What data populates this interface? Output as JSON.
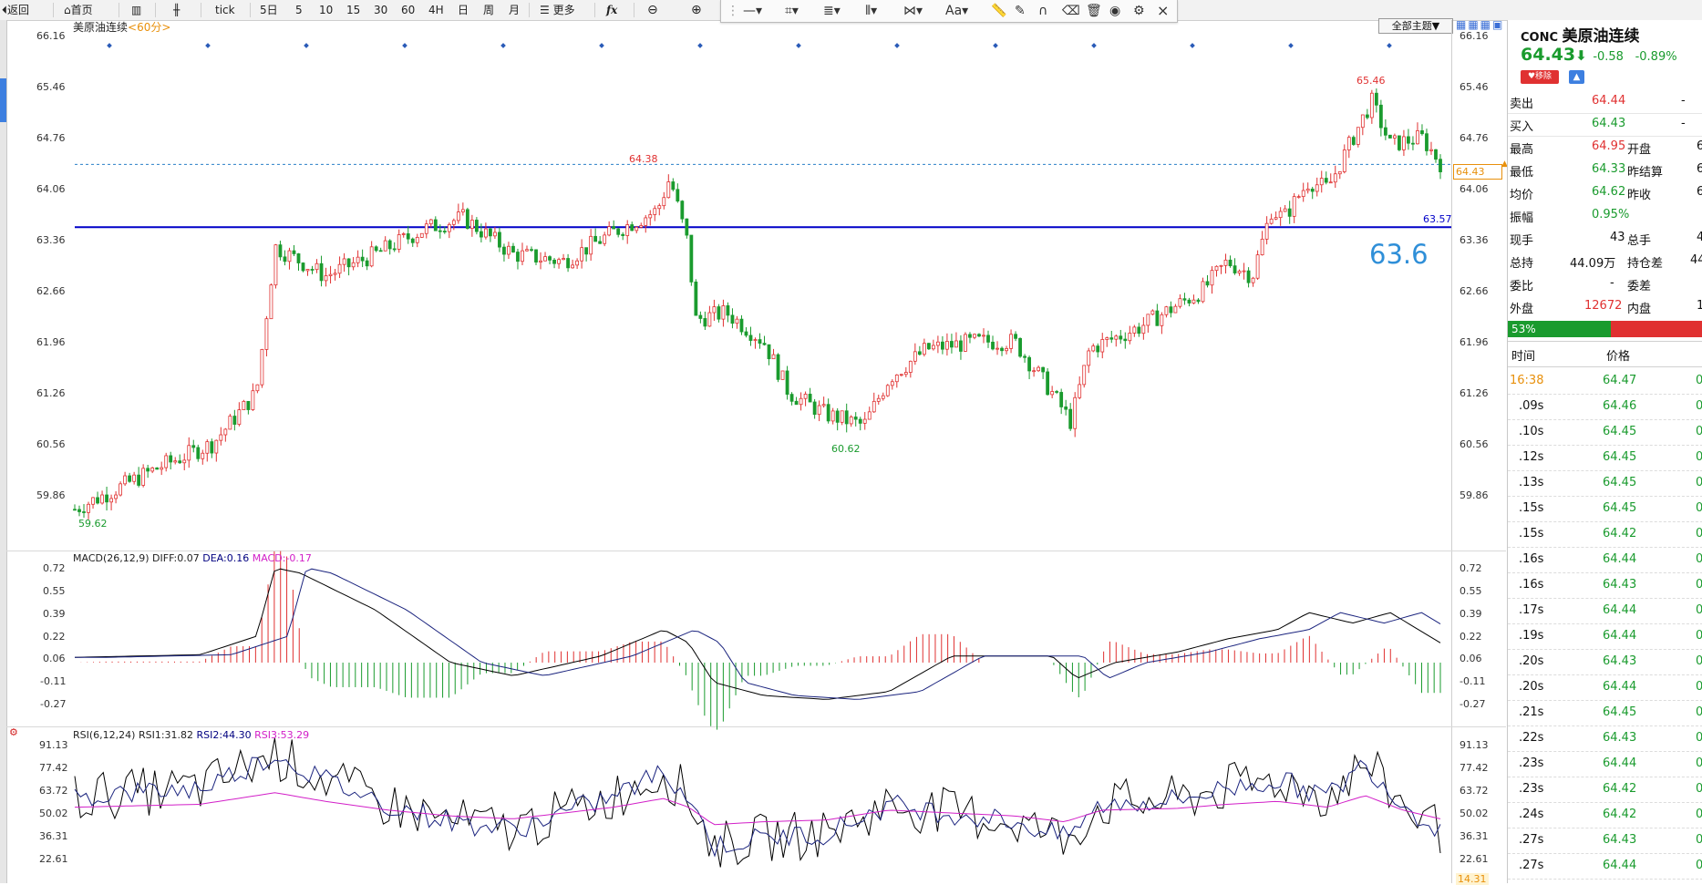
{
  "toolbar": {
    "back": "返回",
    "home": "首页",
    "tick": "tick",
    "periods": [
      "5日",
      "5",
      "10",
      "15",
      "30",
      "60",
      "4H",
      "日",
      "周",
      "月"
    ],
    "more": "更多",
    "fx": "fx"
  },
  "drawbar": {
    "close": "×",
    "text_tool": "Aa"
  },
  "chart": {
    "symbol_title": "美原油连续",
    "period_tag": "<60分>",
    "theme_button": "全部主题▼",
    "price_ticks": [
      "66.16",
      "65.46",
      "64.76",
      "64.06",
      "63.36",
      "62.66",
      "61.96",
      "61.26",
      "60.56",
      "59.86"
    ],
    "right_price_ticks": [
      "66.16",
      "65.46",
      "64.76",
      "64.06",
      "63.36",
      "62.66",
      "61.96",
      "61.26",
      "60.56",
      "59.86"
    ],
    "high_label": "65.46",
    "mid_high_label": "64.38",
    "low_label": "60.62",
    "start_low_label": "59.62",
    "hline_value": "63.57",
    "big_annotation": "63.6",
    "current_price_tag": "64.43",
    "colors": {
      "up": "#e03131",
      "down": "#1a9b2e",
      "hline": "#0000c8"
    }
  },
  "macd": {
    "title": "MACD(26,12,9)",
    "diff": "DIFF:0.07",
    "dea": "DEA:0.16",
    "macd": "MACD:-0.17",
    "ticks": [
      "0.72",
      "0.55",
      "0.39",
      "0.22",
      "0.06",
      "-0.11",
      "-0.27"
    ],
    "right_ticks": [
      "0.72",
      "0.55",
      "0.39",
      "0.22",
      "0.06",
      "-0.11",
      "-0.27"
    ]
  },
  "rsi": {
    "title": "RSI(6,12,24)",
    "rsi1": "RSI1:31.82",
    "rsi2": "RSI2:44.30",
    "rsi3": "RSI3:53.29",
    "ticks": [
      "91.13",
      "77.42",
      "63.72",
      "50.02",
      "36.31",
      "22.61"
    ],
    "right_ticks": [
      "91.13",
      "77.42",
      "63.72",
      "50.02",
      "36.31",
      "22.61"
    ],
    "bottom_right_tag": "14.31"
  },
  "quote": {
    "code": "CONC",
    "name": "美原油连续",
    "price": "64.43",
    "change": "-0.58",
    "change_pct": "-0.89%",
    "remove_btn": "移除",
    "rows": [
      {
        "l": "卖出",
        "v": "64.44",
        "r": "-",
        "rv": ""
      },
      {
        "l": "买入",
        "v": "64.43",
        "r": "-",
        "rv": ""
      },
      {
        "l": "最高",
        "v": "64.95",
        "r": "开盘",
        "rv": "6"
      },
      {
        "l": "最低",
        "v": "64.33",
        "r": "昨结算",
        "rv": "6"
      },
      {
        "l": "均价",
        "v": "64.62",
        "r": "昨收",
        "rv": "6"
      },
      {
        "l": "振幅",
        "v": "0.95%",
        "r": "",
        "rv": ""
      },
      {
        "l": "现手",
        "v": "43",
        "r": "总手",
        "rv": "4"
      },
      {
        "l": "总持",
        "v": "44.09万",
        "r": "持仓差",
        "rv": "44"
      },
      {
        "l": "委比",
        "v": "-",
        "r": "委差",
        "rv": ""
      },
      {
        "l": "外盘",
        "v": "12672",
        "r": "内盘",
        "rv": "1"
      }
    ],
    "ratio": "53%",
    "col_time": "时间",
    "col_price": "价格",
    "ticks": [
      {
        "t": "16:38",
        "p": "64.47",
        "v": "0"
      },
      {
        "t": ".09s",
        "p": "64.46",
        "v": "0"
      },
      {
        "t": ".10s",
        "p": "64.45",
        "v": "0"
      },
      {
        "t": ".12s",
        "p": "64.45",
        "v": "0"
      },
      {
        "t": ".13s",
        "p": "64.45",
        "v": "0"
      },
      {
        "t": ".15s",
        "p": "64.45",
        "v": "0"
      },
      {
        "t": ".15s",
        "p": "64.42",
        "v": "0"
      },
      {
        "t": ".16s",
        "p": "64.44",
        "v": "0"
      },
      {
        "t": ".16s",
        "p": "64.43",
        "v": "0"
      },
      {
        "t": ".17s",
        "p": "64.44",
        "v": "0"
      },
      {
        "t": ".19s",
        "p": "64.44",
        "v": "0"
      },
      {
        "t": ".20s",
        "p": "64.43",
        "v": "0"
      },
      {
        "t": ".20s",
        "p": "64.44",
        "v": "0"
      },
      {
        "t": ".21s",
        "p": "64.45",
        "v": "0"
      },
      {
        "t": ".22s",
        "p": "64.43",
        "v": "0"
      },
      {
        "t": ".23s",
        "p": "64.44",
        "v": "0"
      },
      {
        "t": ".23s",
        "p": "64.42",
        "v": "0"
      },
      {
        "t": ".24s",
        "p": "64.42",
        "v": "0"
      },
      {
        "t": ".27s",
        "p": "64.43",
        "v": "0"
      },
      {
        "t": ".27s",
        "p": "64.44",
        "v": "0"
      }
    ]
  }
}
